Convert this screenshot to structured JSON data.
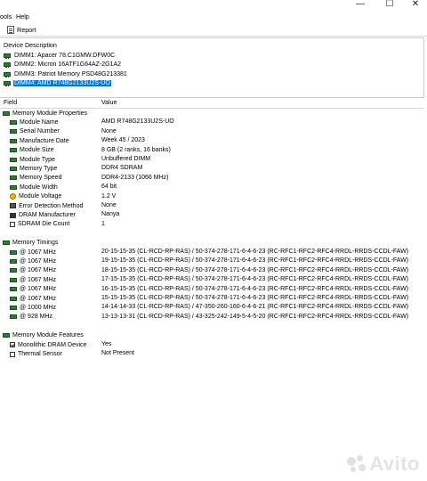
{
  "window": {
    "minimize": "—",
    "maximize": "☐",
    "close": "✕"
  },
  "menu": [
    "ools",
    "Help"
  ],
  "toolbar": {
    "report": "Report"
  },
  "device_panel": {
    "header": "Device Description",
    "items": [
      {
        "label": "DIMM1: Apacer 78.C1GMW.DFW0C",
        "selected": false
      },
      {
        "label": "DIMM2: Micron 16ATF1G64AZ-2G1A2",
        "selected": false
      },
      {
        "label": "DIMM3: Patriot Memory PSD48G213381",
        "selected": false
      },
      {
        "label": "DIMM4: AMD R748G2133U2S-UO",
        "selected": true
      }
    ]
  },
  "table": {
    "col_field": "Field",
    "col_value": "Value"
  },
  "rows": [
    {
      "type": "group",
      "icon": "ram",
      "field": "Memory Module Properties",
      "value": ""
    },
    {
      "type": "prop",
      "icon": "ram",
      "field": "Module Name",
      "value": "AMD R748G2133U2S-UO"
    },
    {
      "type": "prop",
      "icon": "ram",
      "field": "Serial Number",
      "value": "None"
    },
    {
      "type": "prop",
      "icon": "ram",
      "field": "Manufacture Date",
      "value": "Week 45 / 2023"
    },
    {
      "type": "prop",
      "icon": "ram",
      "field": "Module Size",
      "value": "8 GB (2 ranks, 16 banks)"
    },
    {
      "type": "prop",
      "icon": "ram",
      "field": "Module Type",
      "value": "Unbuffered DIMM"
    },
    {
      "type": "prop",
      "icon": "ram",
      "field": "Memory Type",
      "value": "DDR4 SDRAM"
    },
    {
      "type": "prop",
      "icon": "ram",
      "field": "Memory Speed",
      "value": "DDR4-2133 (1066 MHz)"
    },
    {
      "type": "prop",
      "icon": "ram",
      "field": "Module Width",
      "value": "64 bit"
    },
    {
      "type": "prop",
      "icon": "volt",
      "field": "Module Voltage",
      "value": "1.2 V"
    },
    {
      "type": "prop",
      "icon": "err",
      "field": "Error Detection Method",
      "value": "None"
    },
    {
      "type": "prop",
      "icon": "mfr",
      "field": "DRAM Manufacturer",
      "value": "Nanya"
    },
    {
      "type": "prop",
      "icon": "chk",
      "field": "SDRAM Die Count",
      "value": "1"
    },
    {
      "type": "blank"
    },
    {
      "type": "group",
      "icon": "ram",
      "field": "Memory Timings",
      "value": ""
    },
    {
      "type": "prop",
      "icon": "ram",
      "field": "@ 1067 MHz",
      "value": "20-15-15-35  (CL-RCD-RP-RAS) / 50-374-278-171-6-4-6-23  (RC-RFC1-RFC2-RFC4-RRDL-RRDS-CCDL-FAW)"
    },
    {
      "type": "prop",
      "icon": "ram",
      "field": "@ 1067 MHz",
      "value": "19-15-15-35  (CL-RCD-RP-RAS) / 50-374-278-171-6-4-6-23  (RC-RFC1-RFC2-RFC4-RRDL-RRDS-CCDL-FAW)"
    },
    {
      "type": "prop",
      "icon": "ram",
      "field": "@ 1067 MHz",
      "value": "18-15-15-35  (CL-RCD-RP-RAS) / 50-374-278-171-6-4-6-23  (RC-RFC1-RFC2-RFC4-RRDL-RRDS-CCDL-FAW)"
    },
    {
      "type": "prop",
      "icon": "ram",
      "field": "@ 1067 MHz",
      "value": "17-15-15-35  (CL-RCD-RP-RAS) / 50-374-278-171-6-4-6-23  (RC-RFC1-RFC2-RFC4-RRDL-RRDS-CCDL-FAW)"
    },
    {
      "type": "prop",
      "icon": "ram",
      "field": "@ 1067 MHz",
      "value": "16-15-15-35  (CL-RCD-RP-RAS) / 50-374-278-171-6-4-6-23  (RC-RFC1-RFC2-RFC4-RRDL-RRDS-CCDL-FAW)"
    },
    {
      "type": "prop",
      "icon": "ram",
      "field": "@ 1067 MHz",
      "value": "15-15-15-35  (CL-RCD-RP-RAS) / 50-374-278-171-6-4-6-23  (RC-RFC1-RFC2-RFC4-RRDL-RRDS-CCDL-FAW)"
    },
    {
      "type": "prop",
      "icon": "ram",
      "field": "@ 1000 MHz",
      "value": "14-14-14-33  (CL-RCD-RP-RAS) / 47-350-260-160-6-4-6-21  (RC-RFC1-RFC2-RFC4-RRDL-RRDS-CCDL-FAW)"
    },
    {
      "type": "prop",
      "icon": "ram",
      "field": "@ 928 MHz",
      "value": "13-13-13-31  (CL-RCD-RP-RAS) / 43-325-242-149-5-4-5-20  (RC-RFC1-RFC2-RFC4-RRDL-RRDS-CCDL-FAW)"
    },
    {
      "type": "blank"
    },
    {
      "type": "group",
      "icon": "ram",
      "field": "Memory Module Features",
      "value": ""
    },
    {
      "type": "prop",
      "icon": "chk-on",
      "field": "Monolithic DRAM Device",
      "value": "Yes"
    },
    {
      "type": "prop",
      "icon": "chk-off",
      "field": "Thermal Sensor",
      "value": "Not Present"
    }
  ],
  "watermark": "Avito"
}
